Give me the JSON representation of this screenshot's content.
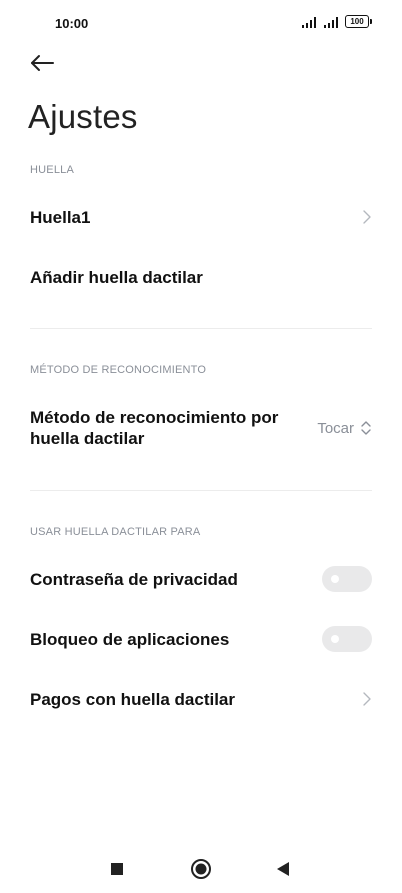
{
  "status": {
    "time": "10:00",
    "battery": "100"
  },
  "header": {
    "title": "Ajustes"
  },
  "sections": {
    "huella": {
      "label": "HUELLA",
      "items": [
        "Huella1",
        "Añadir huella dactilar"
      ]
    },
    "metodo": {
      "label": "MÉTODO DE RECONOCIMIENTO",
      "row_label": "Método de reconocimiento por huella dactilar",
      "value": "Tocar"
    },
    "usar": {
      "label": "USAR HUELLA DACTILAR PARA",
      "items": [
        {
          "label": "Contraseña de privacidad",
          "toggle": false
        },
        {
          "label": "Bloqueo de aplicaciones",
          "toggle": false
        },
        {
          "label": "Pagos con huella dactilar"
        }
      ]
    }
  },
  "icons": {
    "back": "arrow-left-icon",
    "chevron": "chevron-right-icon",
    "updown": "chevron-updown-icon",
    "nav_recents": "square-icon",
    "nav_home": "circle-icon",
    "nav_back": "triangle-left-icon"
  },
  "colors": {
    "muted": "#8a8f98",
    "toggle_off": "#e9e9ea"
  }
}
